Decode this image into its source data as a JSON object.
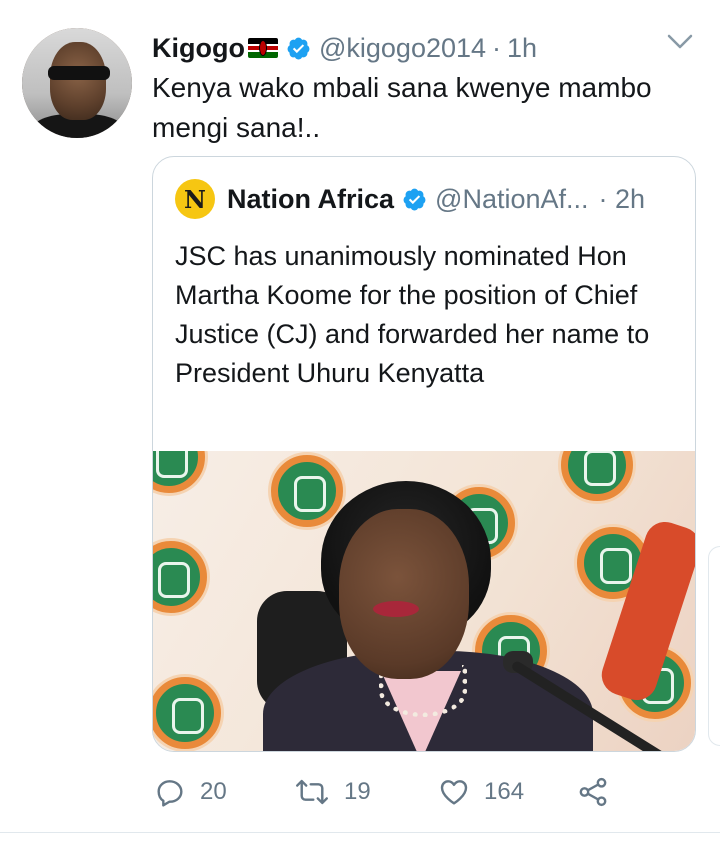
{
  "tweet": {
    "author_name": "Kigogo",
    "author_handle": "@kigogo2014",
    "separator": "·",
    "time": "1h",
    "text": "Kenya wako mbali sana kwenye mambo mengi sana!..",
    "avatar_icon": "profile-photo"
  },
  "quoted_tweet": {
    "avatar_letter": "N",
    "author_name": "Nation Africa",
    "author_handle": "@NationAf...",
    "separator": "·",
    "time": "2h",
    "text": "JSC has unanimously nominated Hon Martha Koome for the position of Chief Justice (CJ) and forwarded her name to President Uhuru Kenyatta",
    "image_description": "photo"
  },
  "actions": {
    "reply_count": "20",
    "retweet_count": "19",
    "like_count": "164"
  },
  "colors": {
    "verified_blue": "#1da1f2",
    "text_primary": "#14171a",
    "text_secondary": "#657786",
    "border": "#ccd6dd",
    "nation_yellow": "#f6c612"
  },
  "icons": {
    "reply": "reply-icon",
    "retweet": "retweet-icon",
    "like": "heart-icon",
    "share": "share-icon",
    "menu": "chevron-down-icon",
    "verified": "verified-badge-icon",
    "flag": "kenya-flag-icon"
  }
}
